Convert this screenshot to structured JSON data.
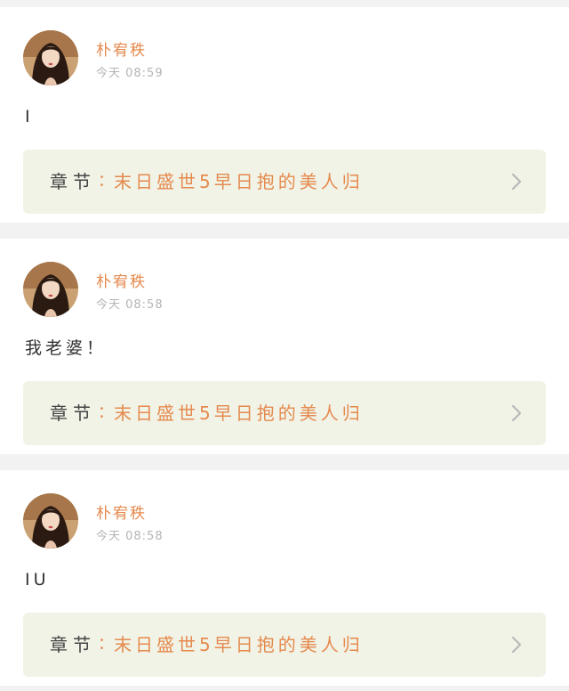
{
  "comments": [
    {
      "username": "朴宥秩",
      "time": "今天 08:59",
      "text": "I",
      "chapter_prefix": "章节",
      "chapter_separator": "：",
      "chapter_title": "末日盛世5早日抱的美人归"
    },
    {
      "username": "朴宥秩",
      "time": "今天 08:58",
      "text": "我老婆！",
      "chapter_prefix": "章节",
      "chapter_separator": "：",
      "chapter_title": "末日盛世5早日抱的美人归"
    },
    {
      "username": "朴宥秩",
      "time": "今天 08:58",
      "text": "IU",
      "chapter_prefix": "章节",
      "chapter_separator": "：",
      "chapter_title": "末日盛世5早日抱的美人归"
    }
  ],
  "icons": {
    "avatar": "user-avatar",
    "chevron": "chevron-right-icon"
  },
  "colors": {
    "accent": "#e58a4e",
    "card_background": "#ffffff",
    "chapter_background": "#f1f3e7",
    "page_background": "#f2f2f2",
    "timestamp": "#b4b4b4",
    "text": "#333333"
  }
}
